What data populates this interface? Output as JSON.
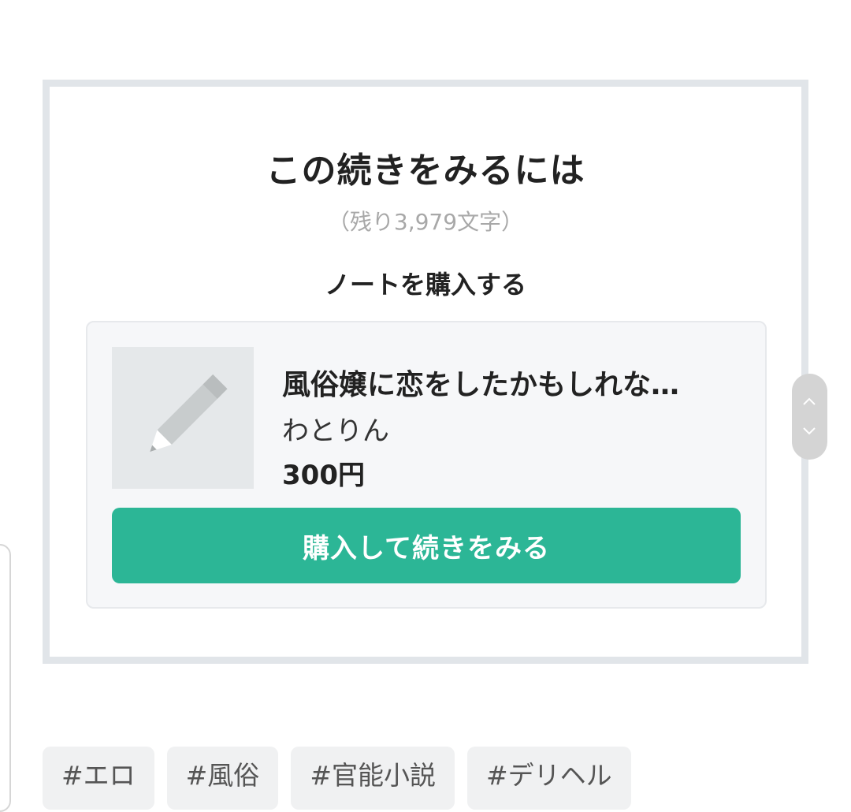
{
  "paywall": {
    "title": "この続きをみるには",
    "remaining": "（残り3,979文字）",
    "subtitle": "ノートを購入する"
  },
  "note": {
    "thumbnail_icon": "pencil-icon",
    "title": "風俗嬢に恋をしたかもしれな…",
    "author": "わとりん",
    "price": "300円",
    "buy_button_label": "購入して続きをみる",
    "accent_color": "#2cb696"
  },
  "scroll_handle": {
    "up_icon": "chevron-up-icon",
    "down_icon": "chevron-down-icon"
  },
  "tags": [
    {
      "label": "#エロ"
    },
    {
      "label": "#風俗"
    },
    {
      "label": "#官能小説"
    },
    {
      "label": "#デリヘル"
    }
  ]
}
